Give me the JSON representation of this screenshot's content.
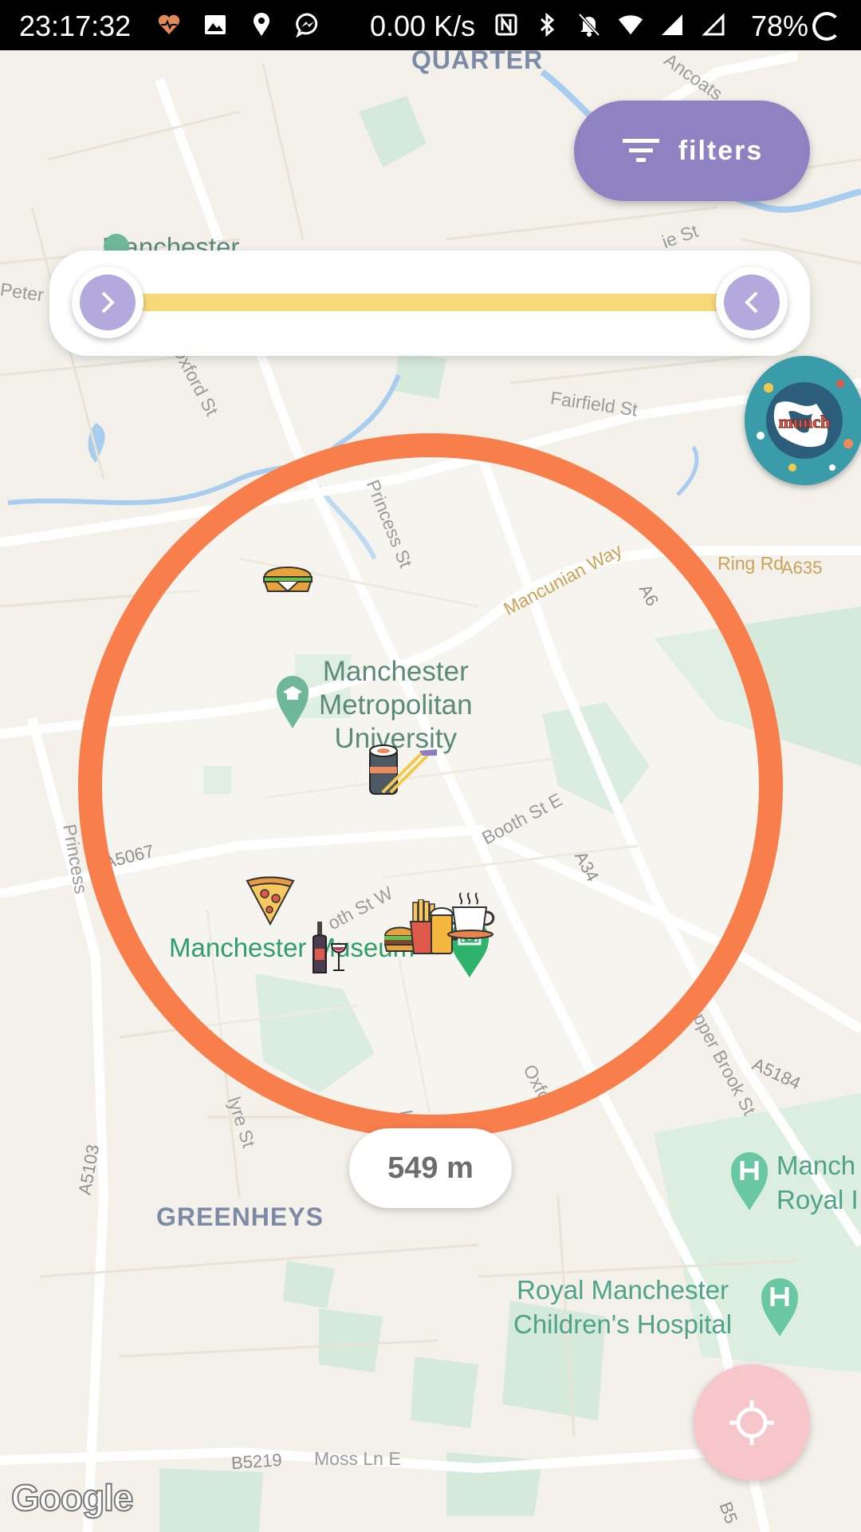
{
  "status_bar": {
    "time": "23:17:32",
    "network_speed": "0.00 K/s",
    "battery": "78%",
    "icons_left": [
      "heart-rate-icon",
      "image-icon",
      "location-icon",
      "messenger-icon"
    ],
    "icons_right": [
      "nfc-icon",
      "bluetooth-icon",
      "mute-icon",
      "wifi-icon",
      "signal-icon",
      "signal-empty-icon"
    ]
  },
  "map": {
    "area_labels": {
      "quarter": "QUARTER",
      "greenheys": "GREENHEYS"
    },
    "streets": {
      "oxford_st": "Oxford St",
      "fairfield_st": "Fairfield St",
      "princess_st": "Princess St",
      "mancunian_way": "Mancunian Way",
      "a6": "A6",
      "ring_rd": "Ring Rd",
      "a635": "A635",
      "a5067": "A5067",
      "booth_st_e": "Booth St E",
      "booth_st_w": "oth St W",
      "a34": "A34",
      "upper_brook_st": "Upper Brook St",
      "a5184": "A5184",
      "a5103": "A5103",
      "ancoats": "Ancoats",
      "peter": "Peter",
      "oxford_rd": "Oxford",
      "lloyd": "Llo",
      "boundary_st": "lyre St",
      "b5219": "B5219",
      "moss_ln_e": "Moss Ln E",
      "b5": "B5",
      "princess_left": "Princess",
      "ie_st": "ie St"
    },
    "pois": {
      "manchester_top": "Manchester",
      "mmu_line1": "Manchester",
      "mmu_line2": "Metropolitan",
      "mmu_line3": "University",
      "museum": "Manchester Museum",
      "royal_line1": "Manch",
      "royal_line2": "Royal I",
      "childrens_line1": "Royal Manchester",
      "childrens_line2": "Children's Hospital"
    },
    "attribution": "Google",
    "search_radius": {
      "label": "549 m",
      "ring_color": "#f87e4b"
    },
    "food_markers": [
      "sandwich-icon",
      "sushi-icon",
      "pizza-icon",
      "wine-icon",
      "burger-icon",
      "fries-icon",
      "beer-icon",
      "coffee-icon"
    ]
  },
  "filters_button": {
    "label": "filters",
    "color": "#8f82c2"
  },
  "price_slider": {
    "min_fraction": 0.0,
    "max_fraction": 1.0,
    "track_color": "#f7d97a",
    "handle_color": "#b3a9dc"
  },
  "logo": {
    "text": "munch"
  },
  "locate_button": {
    "icon": "crosshair-icon",
    "color": "#f7c6cb"
  }
}
